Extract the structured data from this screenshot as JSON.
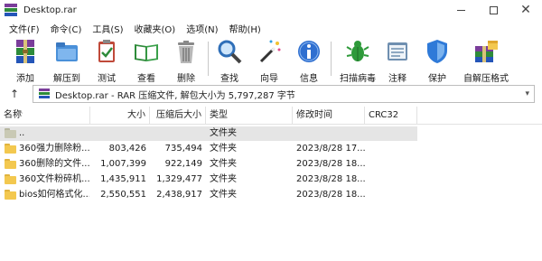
{
  "window": {
    "title": "Desktop.rar",
    "minimize_glyph": "",
    "maximize_glyph": "",
    "close_glyph": "✕"
  },
  "menu": [
    "文件(F)",
    "命令(C)",
    "工具(S)",
    "收藏夹(O)",
    "选项(N)",
    "帮助(H)"
  ],
  "toolbar": [
    {
      "label": "添加",
      "icon": "add-archive-icon"
    },
    {
      "label": "解压到",
      "icon": "extract-to-folder-icon"
    },
    {
      "label": "测试",
      "icon": "test-clipboard-icon"
    },
    {
      "label": "查看",
      "icon": "view-book-icon"
    },
    {
      "label": "删除",
      "icon": "delete-trash-icon"
    },
    {
      "label": "查找",
      "icon": "find-magnifier-icon"
    },
    {
      "label": "向导",
      "icon": "wizard-wand-icon"
    },
    {
      "label": "信息",
      "icon": "info-icon"
    },
    {
      "label": "扫描病毒",
      "icon": "scan-virus-bug-icon"
    },
    {
      "label": "注释",
      "icon": "comment-icon"
    },
    {
      "label": "保护",
      "icon": "protect-shield-icon"
    },
    {
      "label": "自解压格式",
      "icon": "sfx-archive-icon"
    }
  ],
  "address": {
    "up_glyph": "↑",
    "text": "Desktop.rar - RAR 压缩文件, 解包大小为 5,797,287 字节",
    "dropdown_glyph": "▾"
  },
  "columns": {
    "name": "名称",
    "size": "大小",
    "packed": "压缩后大小",
    "type": "类型",
    "modified": "修改时间",
    "crc": "CRC32",
    "sort_glyph": "^"
  },
  "rows": [
    {
      "name": "..",
      "size": "",
      "packed": "",
      "type": "文件夹",
      "modified": "",
      "crc": "",
      "selected": true
    },
    {
      "name": "360强力删除粉...",
      "size": "803,426",
      "packed": "735,494",
      "type": "文件夹",
      "modified": "2023/8/28 17...",
      "crc": ""
    },
    {
      "name": "360删除的文件...",
      "size": "1,007,399",
      "packed": "922,149",
      "type": "文件夹",
      "modified": "2023/8/28 18...",
      "crc": ""
    },
    {
      "name": "360文件粉碎机...",
      "size": "1,435,911",
      "packed": "1,329,477",
      "type": "文件夹",
      "modified": "2023/8/28 18...",
      "crc": ""
    },
    {
      "name": "bios如何格式化...",
      "size": "2,550,551",
      "packed": "2,438,917",
      "type": "文件夹",
      "modified": "2023/8/28 18...",
      "crc": ""
    }
  ]
}
